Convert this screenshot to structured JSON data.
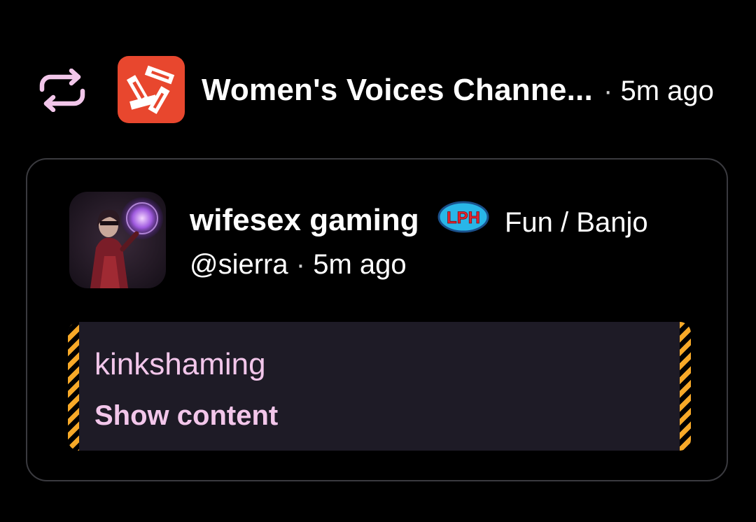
{
  "repost": {
    "icon": "repost-icon",
    "icon_color": "#f2c6ea",
    "channel_name": "Women's Voices Channe...",
    "separator": "·",
    "time": "5m ago",
    "channel_avatar_icon": "channel-logo-icon",
    "channel_avatar_color": "#e8472e"
  },
  "post": {
    "author_display_name": "wifesex gaming",
    "flair_icon": "lph-flair-icon",
    "flair_text": "LPH",
    "community": "Fun / Banjo",
    "handle": "@sierra",
    "separator": "·",
    "time": "5m ago",
    "avatar_icon": "author-avatar-image"
  },
  "content_warning": {
    "reason": "kinkshaming",
    "show_label": "Show content",
    "stripe_color": "#f7a928",
    "text_color": "#f2c6ea",
    "background": "#1e1b26"
  }
}
